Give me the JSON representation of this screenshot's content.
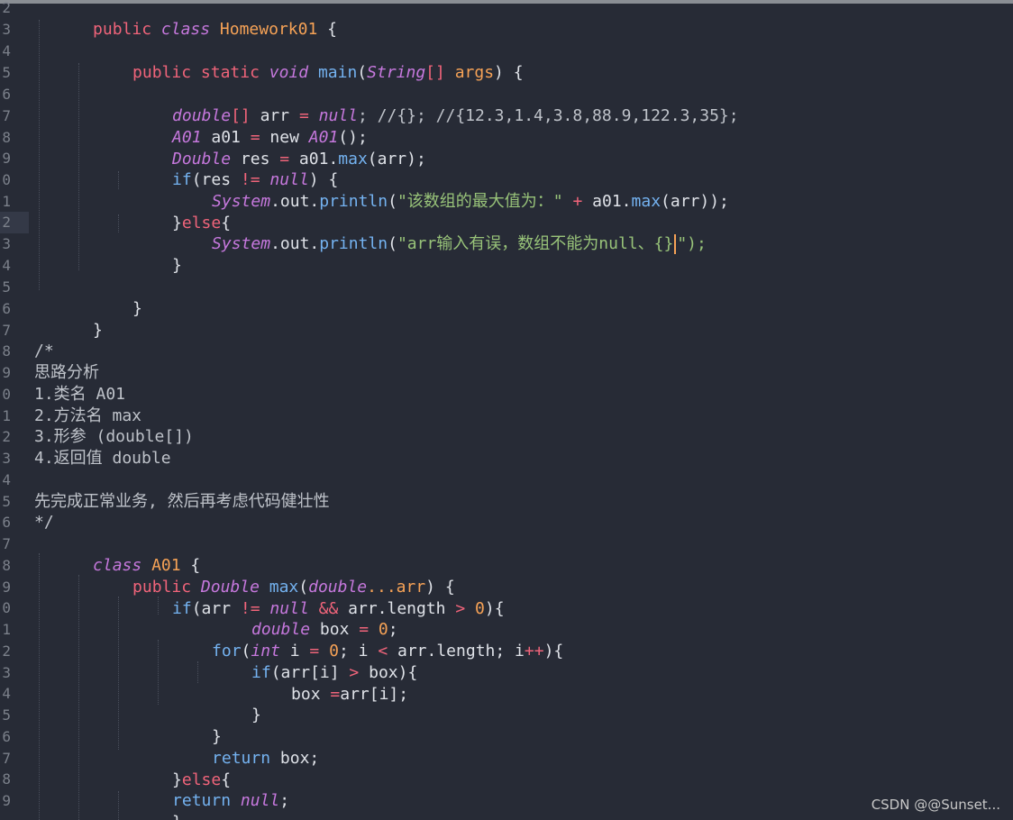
{
  "line_numbers": [
    "2",
    "3",
    "4",
    "5",
    "6",
    "7",
    "8",
    "9",
    "0",
    "1",
    "2",
    "3",
    "4",
    "5",
    "6",
    "7",
    "8",
    "9",
    "0",
    "1",
    "2",
    "3",
    "4",
    "5",
    "6",
    "7",
    "8",
    "9",
    "0",
    "1",
    "2",
    "3",
    "4",
    "5",
    "6",
    "7",
    "8",
    "9"
  ],
  "code": {
    "l2": {
      "t1": "public ",
      "t2": "class ",
      "t3": "Homework01 ",
      "t4": "{"
    },
    "l4": {
      "t1": "public ",
      "t2": "static ",
      "t3": "void ",
      "t4": "main",
      "t5": "(",
      "t6": "String",
      "t7": "[]",
      "t8": " args",
      "t9": ") {"
    },
    "l6": {
      "t1": "double",
      "t2": "[]",
      "t3": " arr ",
      "t4": "=",
      "t5": " null",
      "t6": "; //{}; //{12.3,1.4,3.8,88.9,122.3,35};"
    },
    "l7": {
      "t1": "A01",
      "t2": " a01 ",
      "t3": "=",
      "t4": " new ",
      "t5": "A01",
      "t6": "();"
    },
    "l8": {
      "t1": "Double",
      "t2": " res ",
      "t3": "=",
      "t4": " a01.",
      "t5": "max",
      "t6": "(arr);"
    },
    "l9": {
      "t1": "if",
      "t2": "(res ",
      "t3": "!=",
      "t4": " null",
      "t5": ") {"
    },
    "l10": {
      "t1": "System",
      "t2": ".out.",
      "t3": "println",
      "t4": "(",
      "t5": "\"该数组的最大值为：\"",
      "t6": " + ",
      "t7": "a01.",
      "t8": "max",
      "t9": "(arr));"
    },
    "l11": {
      "t1": "}",
      "t2": "else",
      "t3": "{"
    },
    "l12": {
      "t1": "System",
      "t2": ".out.",
      "t3": "println",
      "t4": "(",
      "t5": "\"arr输入有误，数组不能为null、{}",
      "t6": "\");"
    },
    "l13": {
      "t1": "}"
    },
    "l15": {
      "t1": "}"
    },
    "l16": {
      "t1": "}"
    },
    "l18": {
      "t1": "/*"
    },
    "l19": {
      "t1": "思路分析"
    },
    "l20": {
      "t1": "1.类名 A01"
    },
    "l21": {
      "t1": "2.方法名 max"
    },
    "l22": {
      "t1": "3.形参 (double[])"
    },
    "l23": {
      "t1": "4.返回值 double"
    },
    "l25": {
      "t1": "先完成正常业务, 然后再考虑代码健壮性"
    },
    "l26": {
      "t1": "*/"
    },
    "l27": {
      "t1": "class ",
      "t2": "A01 ",
      "t3": "{"
    },
    "l28": {
      "t1": "public ",
      "t2": "Double ",
      "t3": "max",
      "t4": "(",
      "t5": "double",
      "t6": "...",
      "t7": "arr",
      "t8": ") {"
    },
    "l29": {
      "t1": "if",
      "t2": "(arr ",
      "t3": "!=",
      "t4": " null ",
      "t5": "&&",
      "t6": " arr.length ",
      "t7": ">",
      "t8": " 0",
      "t9": "){"
    },
    "l30": {
      "t1": "double",
      "t2": " box ",
      "t3": "=",
      "t4": " 0",
      "t5": ";"
    },
    "l31": {
      "t1": "for",
      "t2": "(",
      "t3": "int",
      "t4": " i ",
      "t5": "=",
      "t6": " 0",
      "t7": "; i ",
      "t8": "<",
      "t9": " arr.length; i",
      "t10": "++",
      "t11": "){"
    },
    "l32": {
      "t1": "if",
      "t2": "(arr[i] ",
      "t3": ">",
      "t4": " box){"
    },
    "l33": {
      "t1": "box ",
      "t2": "=",
      "t3": "arr[i];"
    },
    "l34": {
      "t1": "}"
    },
    "l35": {
      "t1": "}"
    },
    "l36": {
      "t1": "return ",
      "t2": "box;"
    },
    "l37": {
      "t1": "}",
      "t2": "else",
      "t3": "{"
    },
    "l38": {
      "t1": "return ",
      "t2": "null",
      "t3": ";"
    },
    "l39": {
      "t1": "}"
    },
    "l40": {
      "t1": "}"
    }
  },
  "watermark": "CSDN @@Sunset..."
}
